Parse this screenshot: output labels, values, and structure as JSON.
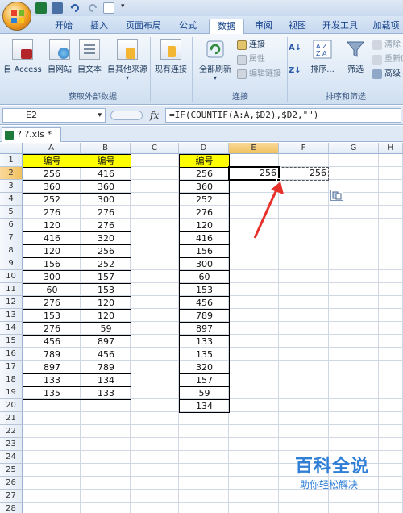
{
  "tabs": [
    "开始",
    "插入",
    "页面布局",
    "公式",
    "数据",
    "审阅",
    "视图",
    "开发工具",
    "加载项"
  ],
  "active_tab": "数据",
  "ribbon": {
    "get_external": {
      "buttons": [
        "自 Access",
        "自网站",
        "自文本",
        "自其他来源",
        "现有连接"
      ],
      "label": "获取外部数据"
    },
    "connections": {
      "refresh_all": "全部刷新",
      "connections": "连接",
      "properties": "属性",
      "edit_links": "编辑链接",
      "label": "连接"
    },
    "sort_filter": {
      "sort": "排序...",
      "filter": "筛选",
      "clear": "清除",
      "reapply": "重新应",
      "advanced": "高级",
      "label": "排序和筛选"
    }
  },
  "name_box": "E2",
  "fx": "fx",
  "formula": "=IF(COUNTIF(A:A,$D2),$D2,\"\")",
  "workbook_tab": "? ?.xls *",
  "columns": [
    "A",
    "B",
    "C",
    "D",
    "E",
    "F",
    "G",
    "H"
  ],
  "rows": [
    "1",
    "2",
    "3",
    "4",
    "5",
    "6",
    "7",
    "8",
    "9",
    "10",
    "11",
    "12",
    "13",
    "14",
    "15",
    "16",
    "17",
    "18",
    "19",
    "20",
    "21",
    "22",
    "23",
    "24",
    "25",
    "26",
    "27",
    "28"
  ],
  "col_a": [
    "编号",
    "256",
    "360",
    "252",
    "276",
    "120",
    "416",
    "120",
    "156",
    "300",
    "60",
    "276",
    "153",
    "276",
    "456",
    "789",
    "897",
    "133",
    "135"
  ],
  "col_b": [
    "编号",
    "416",
    "360",
    "300",
    "276",
    "276",
    "320",
    "256",
    "252",
    "157",
    "153",
    "120",
    "120",
    "59",
    "897",
    "456",
    "789",
    "134",
    "133"
  ],
  "col_d": [
    "编号",
    "256",
    "360",
    "252",
    "276",
    "120",
    "416",
    "156",
    "300",
    "60",
    "153",
    "456",
    "789",
    "897",
    "133",
    "135",
    "320",
    "157",
    "59",
    "134"
  ],
  "e2": "256",
  "f2": "256",
  "watermark": {
    "title": "百科全说",
    "subtitle": "助你轻松解决"
  }
}
